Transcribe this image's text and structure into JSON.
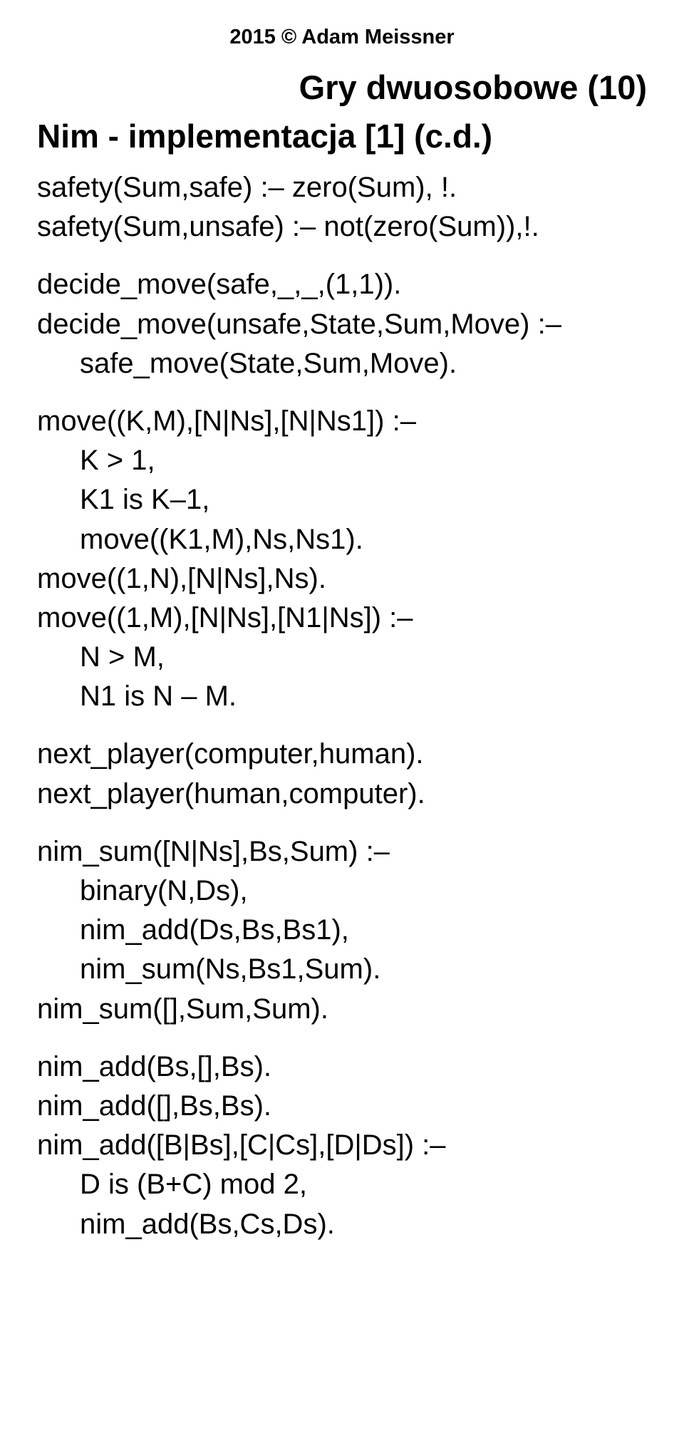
{
  "copyright": "2015 © Adam Meissner",
  "title": "Gry dwuosobowe (10)",
  "subtitle": "Nim - implementacja [1] (c.d.)",
  "blocks": [
    {
      "lines": [
        {
          "text": "safety(Sum,safe) :– zero(Sum), !.",
          "indent": false
        },
        {
          "text": "safety(Sum,unsafe) :– not(zero(Sum)),!.",
          "indent": false
        }
      ]
    },
    {
      "lines": [
        {
          "text": "decide_move(safe,_,_,(1,1)).",
          "indent": false
        },
        {
          "text": "decide_move(unsafe,State,Sum,Move) :–",
          "indent": false
        },
        {
          "text": "safe_move(State,Sum,Move).",
          "indent": true
        }
      ]
    },
    {
      "lines": [
        {
          "text": "move((K,M),[N|Ns],[N|Ns1]) :–",
          "indent": false
        },
        {
          "text": "K > 1,",
          "indent": true
        },
        {
          "text": "K1 is K–1,",
          "indent": true
        },
        {
          "text": "move((K1,M),Ns,Ns1).",
          "indent": true
        },
        {
          "text": "move((1,N),[N|Ns],Ns).",
          "indent": false
        },
        {
          "text": "move((1,M),[N|Ns],[N1|Ns]) :–",
          "indent": false
        },
        {
          "text": "N > M,",
          "indent": true
        },
        {
          "text": "N1 is N – M.",
          "indent": true
        }
      ]
    },
    {
      "lines": [
        {
          "text": "next_player(computer,human).",
          "indent": false
        },
        {
          "text": "next_player(human,computer).",
          "indent": false
        }
      ]
    },
    {
      "lines": [
        {
          "text": "nim_sum([N|Ns],Bs,Sum) :–",
          "indent": false
        },
        {
          "text": "binary(N,Ds),",
          "indent": true
        },
        {
          "text": "nim_add(Ds,Bs,Bs1),",
          "indent": true
        },
        {
          "text": "nim_sum(Ns,Bs1,Sum).",
          "indent": true
        },
        {
          "text": "nim_sum([],Sum,Sum).",
          "indent": false
        }
      ]
    },
    {
      "lines": [
        {
          "text": "nim_add(Bs,[],Bs).",
          "indent": false
        },
        {
          "text": "nim_add([],Bs,Bs).",
          "indent": false
        },
        {
          "text": "nim_add([B|Bs],[C|Cs],[D|Ds]) :–",
          "indent": false
        },
        {
          "text": "D is (B+C) mod 2,",
          "indent": true
        },
        {
          "text": "nim_add(Bs,Cs,Ds).",
          "indent": true
        }
      ]
    }
  ]
}
